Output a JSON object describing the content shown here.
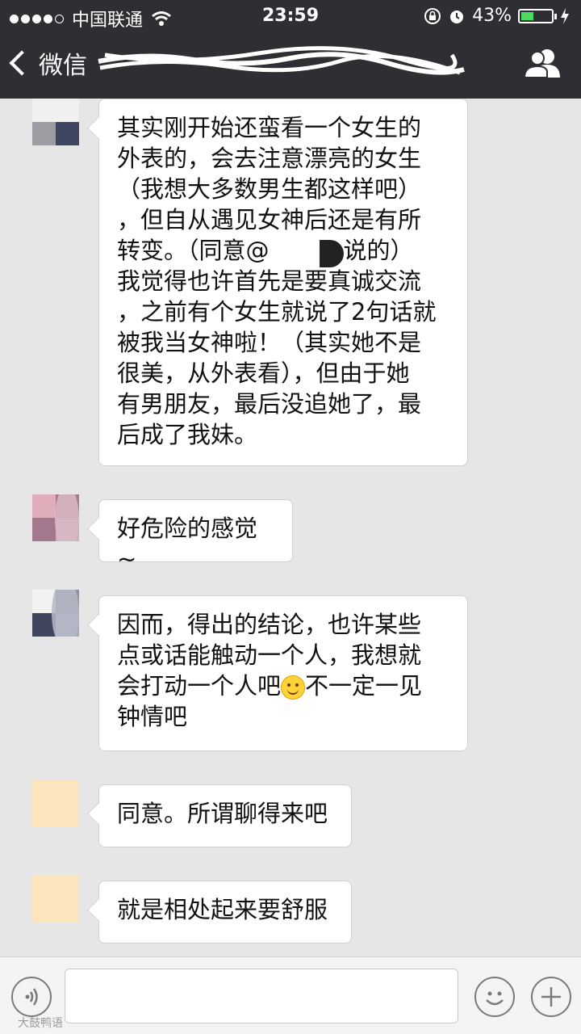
{
  "status_bar": {
    "carrier": "中国联通",
    "time": "23:59",
    "battery": "43%",
    "battery_level": 0.43
  },
  "nav": {
    "back_label": "微信"
  },
  "messages": [
    {
      "segments": [
        "其实刚开始还蛮看一个女生的\n外表的，会去注意漂亮的女生\n（我想大多数男生都这样吧）\n，但自从遇见女神后还是有所\n转变。（同意@",
        "说的）\n我觉得也许首先是要真诚交流\n，之前有个女生就说了2句话就\n被我当女神啦！（其实她不是\n很美，从外表看），但由于她\n有男朋友，最后没追她了，最\n后成了我妹。"
      ]
    },
    {
      "text": "好危险的感觉~"
    },
    {
      "segments": [
        "因而，得出的结论，也许某些\n点或话能触动一个人，我想就\n会打动一个人吧",
        "不一定一见\n钟情吧"
      ]
    },
    {
      "text": "同意。所谓聊得来吧"
    },
    {
      "text": "就是相处起来要舒服"
    }
  ],
  "watermark": "大鼓鸭语",
  "colors": {
    "bar": "#2f2f33",
    "chat_bg": "#e6e6e6",
    "bubble": "#ffffff",
    "battery_fill": "#4cd964"
  },
  "icons": [
    "signal-dots-icon",
    "wifi-icon",
    "lock-rotation-icon",
    "alarm-icon",
    "battery-icon",
    "charging-icon",
    "back-chevron-icon",
    "contacts-icon",
    "voice-icon",
    "smile-icon",
    "plus-icon",
    "smile-emoji-icon"
  ]
}
